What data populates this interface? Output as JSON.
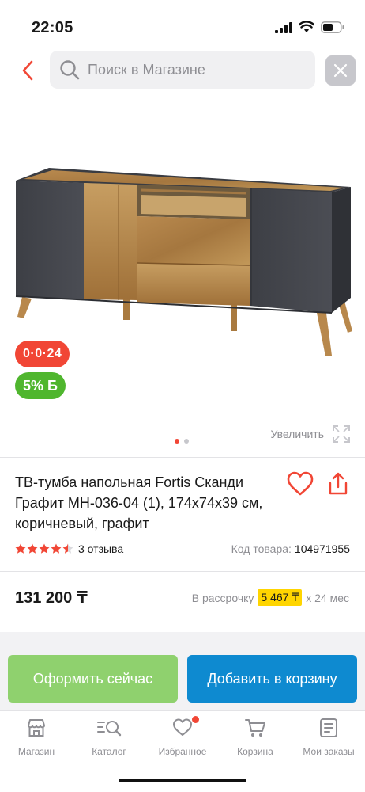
{
  "status_bar": {
    "time": "22:05"
  },
  "search": {
    "placeholder": "Поиск в Магазине"
  },
  "gallery": {
    "badge_installment": "0·0·24",
    "badge_bonus": "5% Б",
    "zoom_label": "Увеличить",
    "page_count": 2,
    "active_page": 1
  },
  "product": {
    "title": "ТВ-тумба напольная Fortis Сканди Графит МН-036-04 (1), 174х74х39 см, коричневый, графит",
    "rating": 4.5,
    "reviews": "3 отзыва",
    "code_label": "Код товара:",
    "code_value": "104971955",
    "price": "131 200 ₸",
    "installment_prefix": "В рассрочку",
    "installment_amount": "5 467 ₸",
    "installment_suffix": "х 24 мес"
  },
  "actions": {
    "checkout_label": "Оформить сейчас",
    "cart_label": "Добавить в корзину"
  },
  "nav": {
    "items": [
      {
        "label": "Магазин",
        "icon": "store-icon"
      },
      {
        "label": "Каталог",
        "icon": "catalog-search-icon"
      },
      {
        "label": "Избранное",
        "icon": "heart-icon"
      },
      {
        "label": "Корзина",
        "icon": "cart-icon"
      },
      {
        "label": "Мои заказы",
        "icon": "orders-icon"
      }
    ]
  },
  "colors": {
    "accent_red": "#f14635",
    "bonus_green": "#4fb62e",
    "checkout_green": "#8fd16e",
    "cart_blue": "#0e8ad0",
    "installment_yellow": "#ffd500"
  }
}
